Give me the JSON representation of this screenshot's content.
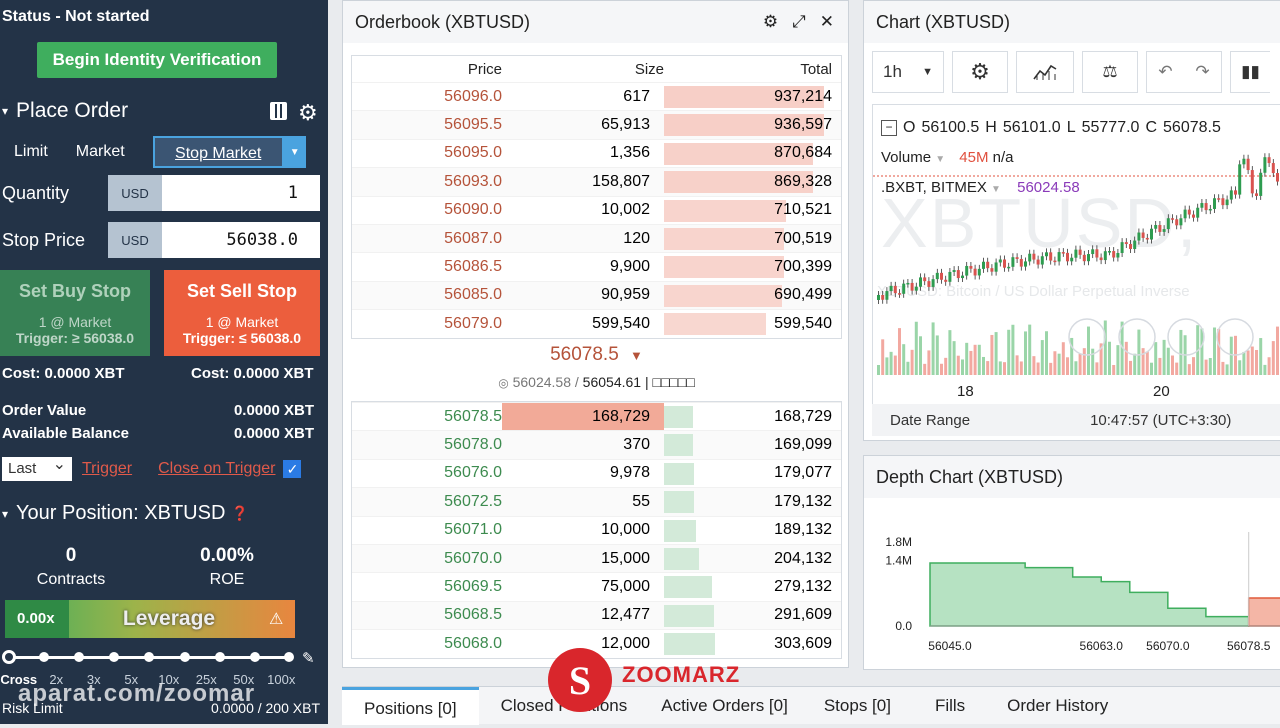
{
  "left": {
    "status": "Status - Not started",
    "verify_button": "Begin Identity Verification",
    "place_order_title": "Place Order",
    "tabs": {
      "limit": "Limit",
      "market": "Market",
      "stop_market": "Stop Market"
    },
    "quantity": {
      "label": "Quantity",
      "unit": "USD",
      "value": "1"
    },
    "stop_price": {
      "label": "Stop Price",
      "unit": "USD",
      "value": "56038.0"
    },
    "buy": {
      "title": "Set Buy Stop",
      "line1": "1 @ Market",
      "line2": "Trigger: ≥ 56038.0"
    },
    "sell": {
      "title": "Set Sell Stop",
      "line1": "1 @ Market",
      "line2": "Trigger: ≤ 56038.0"
    },
    "cost_left": "Cost: 0.0000 XBT",
    "cost_right": "Cost: 0.0000 XBT",
    "order_value": {
      "label": "Order Value",
      "value": "0.0000 XBT"
    },
    "available_balance": {
      "label": "Available Balance",
      "value": "0.0000 XBT"
    },
    "trigger_select": "Last",
    "trigger_link": "Trigger",
    "close_on_trigger": "Close on Trigger",
    "position_title": "Your Position: XBTUSD",
    "contracts": {
      "value": "0",
      "label": "Contracts"
    },
    "roe": {
      "value": "0.00%",
      "label": "ROE"
    },
    "leverage": {
      "value": "0.00x",
      "label": "Leverage"
    },
    "leverage_ticks": [
      "Cross",
      "2x",
      "3x",
      "5x",
      "10x",
      "25x",
      "50x",
      "100x"
    ],
    "risk_limit": {
      "label": "Risk Limit",
      "value": "0.0000 / 200 XBT"
    },
    "watermark": "aparat.com/zoomar"
  },
  "orderbook": {
    "title": "Orderbook (XBTUSD)",
    "headers": {
      "price": "Price",
      "size": "Size",
      "total": "Total"
    },
    "asks": [
      {
        "price": "56096.0",
        "size": "617",
        "total": "937,214",
        "depth": 1.0
      },
      {
        "price": "56095.5",
        "size": "65,913",
        "total": "936,597",
        "depth": 1.0
      },
      {
        "price": "56095.0",
        "size": "1,356",
        "total": "870,684",
        "depth": 0.93
      },
      {
        "price": "56093.0",
        "size": "158,807",
        "total": "869,328",
        "depth": 0.93
      },
      {
        "price": "56090.0",
        "size": "10,002",
        "total": "710,521",
        "depth": 0.76
      },
      {
        "price": "56087.0",
        "size": "120",
        "total": "700,519",
        "depth": 0.75
      },
      {
        "price": "56086.5",
        "size": "9,900",
        "total": "700,399",
        "depth": 0.75
      },
      {
        "price": "56085.0",
        "size": "90,959",
        "total": "690,499",
        "depth": 0.74
      },
      {
        "price": "56079.0",
        "size": "599,540",
        "total": "599,540",
        "depth": 0.64
      }
    ],
    "mid_price": "56078.5",
    "index_price": "56024.58",
    "mark_price": "56054.61",
    "mid_suffix": "| □□□□□",
    "bids": [
      {
        "price": "56078.5",
        "size": "168,729",
        "total": "168,729",
        "depth": 0.18,
        "hl": true
      },
      {
        "price": "56078.0",
        "size": "370",
        "total": "169,099",
        "depth": 0.18
      },
      {
        "price": "56076.0",
        "size": "9,978",
        "total": "179,077",
        "depth": 0.19
      },
      {
        "price": "56072.5",
        "size": "55",
        "total": "179,132",
        "depth": 0.19
      },
      {
        "price": "56071.0",
        "size": "10,000",
        "total": "189,132",
        "depth": 0.2
      },
      {
        "price": "56070.0",
        "size": "15,000",
        "total": "204,132",
        "depth": 0.22
      },
      {
        "price": "56069.5",
        "size": "75,000",
        "total": "279,132",
        "depth": 0.3
      },
      {
        "price": "56068.5",
        "size": "12,477",
        "total": "291,609",
        "depth": 0.31
      },
      {
        "price": "56068.0",
        "size": "12,000",
        "total": "303,609",
        "depth": 0.32
      }
    ]
  },
  "chart": {
    "title": "Chart (XBTUSD)",
    "interval": "1h",
    "ohlc": {
      "o": "O",
      "ov": "56100.5",
      "h": "H",
      "hv": "56101.0",
      "l": "L",
      "lv": "55777.0",
      "c": "C",
      "cv": "56078.5"
    },
    "volume": {
      "label": "Volume",
      "value": "45M",
      "extra": "n/a"
    },
    "index": {
      "label": ".BXBT, BITMEX",
      "value": "56024.58"
    },
    "watermark": "XBTUSD,",
    "watermark_sub": "XBTUSD: Bitcoin / US Dollar Perpetual Inverse",
    "x_labels": [
      "18",
      "20"
    ],
    "date_range": "Date Range",
    "time": "10:47:57 (UTC+3:30)"
  },
  "depth": {
    "title": "Depth Chart (XBTUSD)",
    "chart_data": {
      "type": "area",
      "y_ticks": [
        "1.8M",
        "1.4M",
        "0.0"
      ],
      "x_ticks": [
        "56045.0",
        "56063.0",
        "56070.0",
        "56078.5"
      ],
      "series": [
        {
          "name": "bids",
          "color": "#3fae5e",
          "x": [
            56045.0,
            56055.0,
            56060.0,
            56063.0,
            56066.0,
            56070.0,
            56074.0,
            56078.5
          ],
          "y": [
            1.35,
            1.25,
            1.05,
            0.95,
            0.72,
            0.38,
            0.2,
            0.17
          ]
        },
        {
          "name": "asks",
          "color": "#e05a3a",
          "x": [
            56078.5,
            56082.0
          ],
          "y": [
            0.6,
            0.6
          ]
        }
      ]
    }
  },
  "bottom_tabs": [
    "Positions [0]",
    "Closed Positions",
    "Active Orders [0]",
    "Stops [0]",
    "Fills",
    "Order History"
  ],
  "brand_watermark": "ZOOMARZ",
  "colors": {
    "panel": "#233347",
    "green": "#3fae5e",
    "red": "#e05a3a",
    "accent": "#4aa3df"
  }
}
